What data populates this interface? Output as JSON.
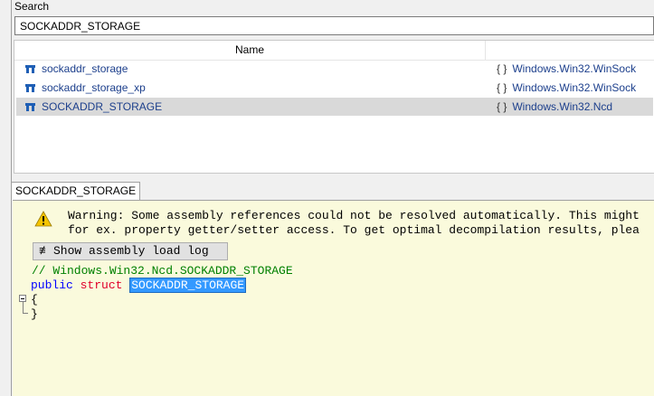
{
  "search": {
    "label": "Search",
    "value": "SOCKADDR_STORAGE"
  },
  "results": {
    "column_name": "Name",
    "rows": [
      {
        "name": "sockaddr_storage",
        "ns_icon": "{ }",
        "namespace": "Windows.Win32.WinSock"
      },
      {
        "name": "sockaddr_storage_xp",
        "ns_icon": "{ }",
        "namespace": "Windows.Win32.WinSock"
      },
      {
        "name": "SOCKADDR_STORAGE",
        "ns_icon": "{ }",
        "namespace": "Windows.Win32.Ncd"
      }
    ]
  },
  "tab": {
    "title": "SOCKADDR_STORAGE"
  },
  "editor": {
    "warning_line1": "Warning: Some assembly references could not be resolved automatically. This might",
    "warning_line2": "for ex. property getter/setter access. To get optimal decompilation results, plea",
    "load_button": "Show assembly load log",
    "comment": "// Windows.Win32.Ncd.SOCKADDR_STORAGE",
    "kw_public": "public",
    "kw_struct": "struct",
    "type_name": "SOCKADDR_STORAGE",
    "brace_open": "{",
    "brace_close": "}"
  },
  "icons": {
    "struct": "struct-icon",
    "warning": "warning-icon",
    "log": "log-icon"
  }
}
